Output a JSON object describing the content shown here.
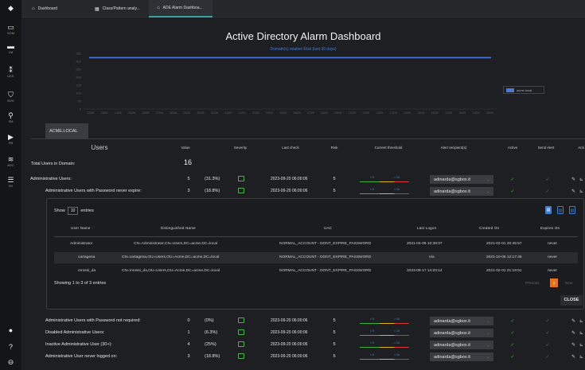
{
  "sidebar": {
    "items": [
      {
        "icon": "diamond-logo",
        "label": ""
      },
      {
        "icon": "monitor-icon",
        "label": "SOM"
      },
      {
        "icon": "archive-icon",
        "label": ""
      },
      {
        "icon": "list-icon",
        "label": "LM"
      },
      {
        "icon": "network-icon",
        "label": ""
      },
      {
        "icon": "uce-icon",
        "label": "UCE"
      },
      {
        "icon": "shield-icon",
        "label": "NVS"
      },
      {
        "icon": "search-icon",
        "label": "SM"
      },
      {
        "icon": "play-icon",
        "label": "PB"
      },
      {
        "icon": "layers-icon",
        "label": "ADC"
      },
      {
        "icon": "menu-list-icon",
        "label": "IM"
      },
      {
        "icon": "chat-icon",
        "label": ""
      },
      {
        "icon": "help-icon",
        "label": ""
      },
      {
        "icon": "user-icon",
        "label": ""
      }
    ]
  },
  "tabs": [
    {
      "label": "Dashboard",
      "icon": "home-icon"
    },
    {
      "label": "Class/Pattern analy...",
      "icon": "grid-icon"
    },
    {
      "label": "ADE Alarm Dashboa...",
      "icon": "home-icon"
    }
  ],
  "page": {
    "title": "Active Directory Alarm Dashboard",
    "subtitle": "Domain(s) relative Risk (last 30 days)"
  },
  "chart_data": {
    "type": "line",
    "title": "Domain(s) relative Risk (last 30 days)",
    "ylim": [
      0,
      350
    ],
    "yticks": [
      0,
      50,
      100,
      150,
      200,
      250,
      300,
      350
    ],
    "x": [
      "22/08",
      "23/08",
      "24/08",
      "25/08",
      "26/08",
      "27/08",
      "28/08",
      "29/08",
      "30/08",
      "31/08",
      "01/09",
      "02/09",
      "03/09",
      "04/09",
      "05/09",
      "06/09",
      "07/09",
      "08/09",
      "09/09",
      "10/09",
      "11/09",
      "12/09",
      "13/09",
      "14/09",
      "15/09",
      "16/09",
      "17/09",
      "18/09",
      "19/09",
      "20/09"
    ],
    "series": [
      {
        "name": "acme.local",
        "color": "#4a78d6",
        "values": [
          323,
          323,
          323,
          323,
          323,
          323,
          323,
          323,
          323,
          323,
          323,
          323,
          323,
          323,
          323,
          323,
          323,
          323,
          323,
          323,
          323,
          323,
          323,
          323,
          323,
          323,
          323,
          323,
          323,
          323
        ]
      }
    ],
    "legend": "right",
    "grid": false
  },
  "domain_tab": "ACME.LOCAL",
  "users_table": {
    "headers": {
      "users": "Users",
      "value": "Value",
      "severity": "Severity",
      "last_check": "Last check",
      "risk": "Risk",
      "threshold": "Current threshold",
      "recipients": "Alert recipient(s)",
      "active": "Active",
      "send_alert": "Send Alert",
      "actions": "Acti"
    },
    "total": {
      "label": "Total Users in Domain:",
      "value": "16"
    },
    "threshold_low": "< 5",
    "threshold_high": "> 10",
    "rows": [
      {
        "name": "Administrative Users:",
        "value": "5",
        "pct": "(31.3%)",
        "date": "2023-09-20 06:00:06",
        "risk": "5",
        "recipient": "adinarda@sgbox.it"
      },
      {
        "name": "Administrative Users with Password never expire:",
        "value": "3",
        "pct": "(18.8%)",
        "date": "2023-09-20 06:00:06",
        "risk": "5",
        "recipient": "adinarda@sgbox.it"
      },
      {
        "name": "Administrative Users with Password not required:",
        "value": "0",
        "pct": "(0%)",
        "date": "2023-09-20 06:00:06",
        "risk": "5",
        "recipient": "adinarda@sgbox.it"
      },
      {
        "name": "Disabled Administrative Users:",
        "value": "1",
        "pct": "(6.3%)",
        "date": "2023-09-20 06:00:06",
        "risk": "5",
        "recipient": "adinarda@sgbox.it"
      },
      {
        "name": "Inactive Administrative User (30+):",
        "value": "4",
        "pct": "(25%)",
        "date": "2023-09-20 06:00:06",
        "risk": "5",
        "recipient": "adinarda@sgbox.it"
      },
      {
        "name": "Administrative User never logged on:",
        "value": "3",
        "pct": "(18.8%)",
        "date": "2023-09-20 06:00:06",
        "risk": "5",
        "recipient": "adinarda@sgbox.it"
      }
    ]
  },
  "detail": {
    "show_label": "Show",
    "show_value": "10",
    "entries_label": "entries",
    "headers": {
      "user": "User Name",
      "dn": "Distinguished Name",
      "uac": "UAC",
      "logon": "Last Logon",
      "created": "Created On",
      "expires": "Expires On"
    },
    "rows": [
      {
        "user": "Administrator",
        "dn": "CN=Administrator,CN=Users,DC=acme,DC=local",
        "uac": "NORMAL_ACCOUNT - DONT_EXPIRE_PASSWORD",
        "logon": "2021-04-06 10:38:07",
        "created": "2021-02-01 20:45:57",
        "expires": "never"
      },
      {
        "user": "cartagena",
        "dn": "CN=cartagena,OU=Users,OU=Acme,DC=acme,DC=local",
        "uac": "NORMAL_ACCOUNT - DONT_EXPIRE_PASSWORD",
        "logon": "n/a",
        "created": "2021-10-05 12:17:46",
        "expires": "never"
      },
      {
        "user": "mrossi_da",
        "dn": "CN=mrossi_da,OU=Users,OU=Acme,DC=acme,DC=local",
        "uac": "NORMAL_ACCOUNT - DONT_EXPIRE_PASSWORD",
        "logon": "2023-09-17 14:20:14",
        "created": "2021-02-01 21:19:51",
        "expires": "never"
      }
    ],
    "showing": "Showing 1 to 3 of 3 entries",
    "previous": "Previous",
    "page": "1",
    "next": "Next",
    "close": "CLOSE"
  }
}
